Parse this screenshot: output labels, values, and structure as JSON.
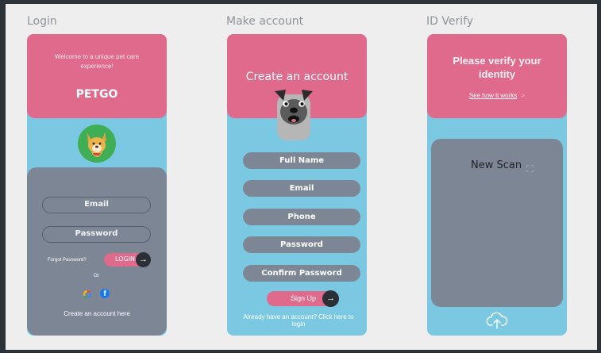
{
  "screens": {
    "login": {
      "title": "Login",
      "welcome": "Welcome to a unique pet care experience!",
      "brand": "PETGO",
      "email_label": "Email",
      "password_label": "Password",
      "forgot_password": "Forgot Password?",
      "login_button": "LOGIN",
      "or_text": "Or",
      "create_account_link": "Create an account here"
    },
    "make_account": {
      "title": "Make account",
      "heading": "Create an account",
      "fields": [
        "Full Name",
        "Email",
        "Phone",
        "Password",
        "Confirm Password"
      ],
      "signup_button": "Sign Up",
      "login_link": "Already have an account? Click here to login"
    },
    "id_verify": {
      "title": "ID Verify",
      "heading": "Please verify your identity",
      "how_link": "See how it works",
      "how_chevron": ">",
      "scan_label": "New Scan"
    }
  },
  "icons": {
    "arrow": "→",
    "google": "google-icon",
    "facebook": "facebook-icon",
    "upload": "upload-cloud-icon",
    "scan": "scan-icon"
  },
  "colors": {
    "pink": "#df6a8c",
    "blue": "#7bc8e2",
    "gray": "#7c8694",
    "dark": "#2b2f36"
  }
}
